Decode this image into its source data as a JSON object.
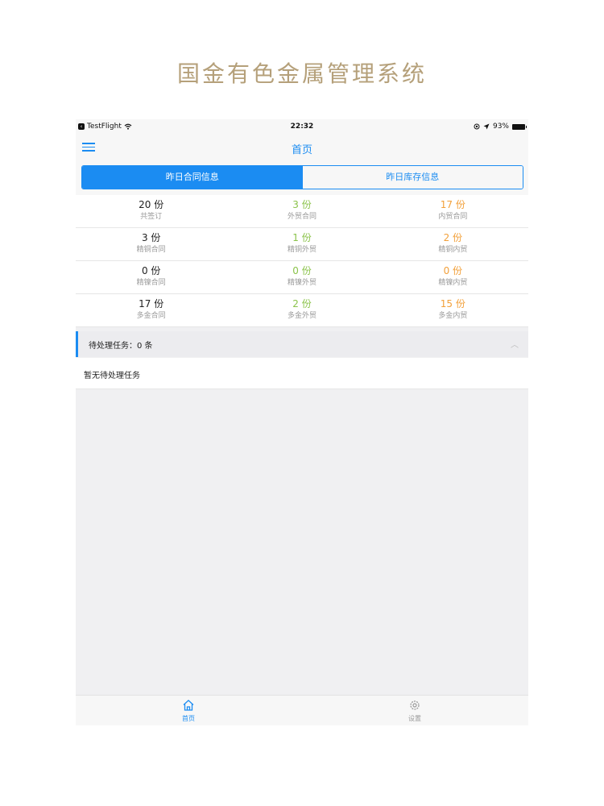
{
  "heading": "国金有色金属管理系统",
  "status_bar": {
    "carrier": "TestFlight",
    "time": "22:32",
    "battery": "93%"
  },
  "nav": {
    "title": "首页"
  },
  "segments": {
    "active": "昨日合同信息",
    "inactive": "昨日库存信息"
  },
  "stats": [
    [
      {
        "value": "20 份",
        "label": "共签订"
      },
      {
        "value": "3 份",
        "label": "外贸合同"
      },
      {
        "value": "17 份",
        "label": "内贸合同"
      }
    ],
    [
      {
        "value": "3 份",
        "label": "精铜合同"
      },
      {
        "value": "1 份",
        "label": "精铜外贸"
      },
      {
        "value": "2 份",
        "label": "精铜内贸"
      }
    ],
    [
      {
        "value": "0 份",
        "label": "精镍合同"
      },
      {
        "value": "0 份",
        "label": "精镍外贸"
      },
      {
        "value": "0 份",
        "label": "精镍内贸"
      }
    ],
    [
      {
        "value": "17 份",
        "label": "多金合同"
      },
      {
        "value": "2 份",
        "label": "多金外贸"
      },
      {
        "value": "15 份",
        "label": "多金内贸"
      }
    ]
  ],
  "tasks": {
    "header": "待处理任务：0 条",
    "empty": "暂无待处理任务"
  },
  "tabbar": {
    "home": "首页",
    "settings": "设置"
  },
  "colors": {
    "accent": "#1b8cf2",
    "green": "#8bc34a",
    "orange": "#f2a03a",
    "heading": "#b5a07a"
  }
}
